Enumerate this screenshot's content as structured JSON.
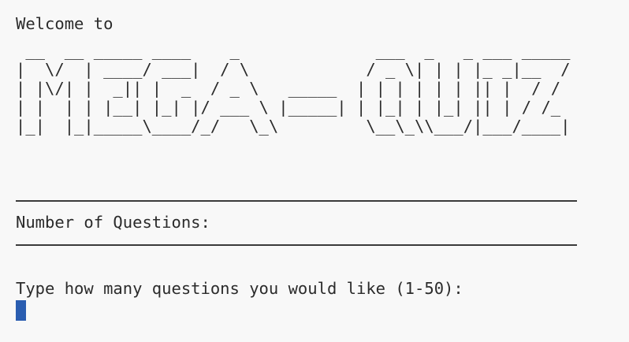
{
  "terminal": {
    "welcome_text": "Welcome to",
    "banner_ascii": " __  __ _____ ____    _              ___  _   _ ___ _____\n|  \\/  | ____/ ___|  / \\            / _ \\| | | |_ _|__  /\n| |\\/| |  _|| |  _  / _ \\   _____  | | | | | | || |  / /\n| |  | | |__| |_| |/ ___ \\ |_____| | |_| | |_| || | / /_\n|_|  |_|_____\\____/_/   \\_\\         \\__\\_\\\\___/|___/____|",
    "section_title": "Number of Questions:",
    "prompt_text": "Type how many questions you would like (1-50):",
    "cursor_color": "#2a5db0"
  }
}
